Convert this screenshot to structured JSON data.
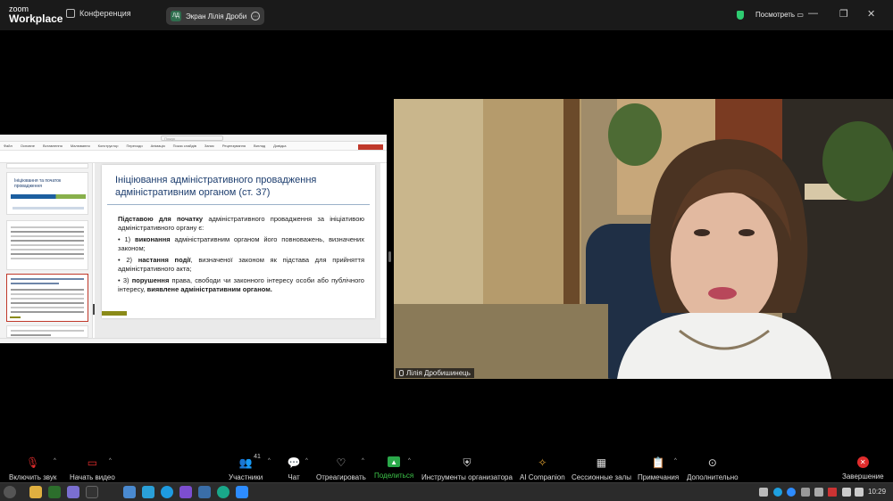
{
  "app": {
    "logo_line1": "zoom",
    "logo_line2": "Workplace",
    "conference_label": "Конференция",
    "screen_share_pill": {
      "avatar": "ЛД",
      "label": "Экран Лілія Дробиши..."
    },
    "view_label": "Посмотреть",
    "window_controls": [
      "—",
      "❐",
      "✕"
    ]
  },
  "shared_screen": {
    "search_placeholder": "Пошук",
    "ribbon_tabs": [
      "Файл",
      "Основне",
      "Вставлення",
      "Малювання",
      "Конструктор",
      "Переходи",
      "Анімація",
      "Показ слайдів",
      "Запис",
      "Рецензування",
      "Вигляд",
      "Довідка"
    ],
    "thumbnail_title": "Ініціювання та початок провадження",
    "slide": {
      "title": "Ініціювання адміністративного провадження адміністративним органом (ст. 37)",
      "intro_bold": "Підставою для початку",
      "intro_rest": " адміністративного провадження за ініціативою адміністративного органу є:",
      "items": [
        {
          "prefix": "• 1) ",
          "bold": "виконання",
          "rest": " адміністративним органом його повноважень, визначених законом;"
        },
        {
          "prefix": "• 2) ",
          "bold": "настання події",
          "rest": ", визначеної законом як підстава для прийняття адміністративного акта;"
        },
        {
          "prefix": "• 3) ",
          "bold": "порушення",
          "rest": " права, свободи чи законного інтересу особи або публічного інтересу, ",
          "bold2": "виявлене адміністративним органом."
        }
      ]
    }
  },
  "video": {
    "participant_name": "Лілія Дробишинець"
  },
  "toolbar": {
    "mute": "Включить звук",
    "video": "Начать видео",
    "participants": "Участники",
    "participants_count": "41",
    "chat": "Чат",
    "react": "Отреагировать",
    "share": "Поделиться",
    "host_tools": "Инструменты организатора",
    "ai": "AI Companion",
    "breakout": "Сессионные залы",
    "notes": "Примечания",
    "more": "Дополнительно",
    "end": "Завершение"
  },
  "taskbar": {
    "time": "10:29"
  },
  "colors": {
    "share_green": "#3ec74a",
    "end_red": "#e02c2c",
    "slide_title_blue": "#1c3d6e"
  }
}
